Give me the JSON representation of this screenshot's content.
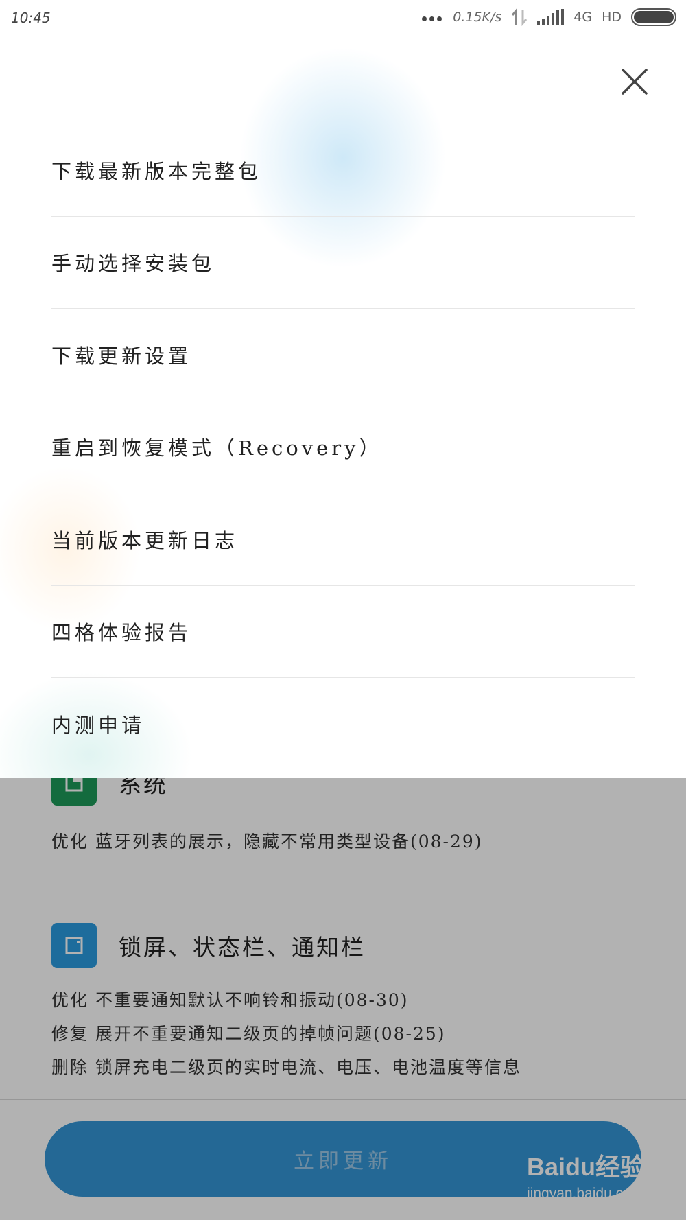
{
  "status_bar": {
    "time": "10:45",
    "net_speed": "0.15K/s",
    "network": "4G",
    "hd": "HD"
  },
  "menu": {
    "items": [
      {
        "label": "下载最新版本完整包"
      },
      {
        "label": "手动选择安装包"
      },
      {
        "label": "下载更新设置"
      },
      {
        "label": "重启到恢复模式（Recovery）"
      },
      {
        "label": "当前版本更新日志"
      },
      {
        "label": "四格体验报告"
      },
      {
        "label": "内测申请"
      }
    ]
  },
  "background": {
    "system_section": {
      "title": "系统",
      "notes": [
        "优化 蓝牙列表的展示，隐藏不常用类型设备(08-29)"
      ]
    },
    "lockscreen_section": {
      "title": "锁屏、状态栏、通知栏",
      "notes": [
        "优化 不重要通知默认不响铃和振动(08-30)",
        "修复 展开不重要通知二级页的掉帧问题(08-25)",
        "删除 锁屏充电二级页的实时电流、电压、电池温度等信息"
      ]
    },
    "update_button_label": "立即更新"
  },
  "colors": {
    "system_icon": "#1e9a5a",
    "lockscreen_icon": "#2a9be0",
    "update_button": "#3496d6"
  },
  "watermark": {
    "brand": "Baidu经验",
    "url": "jingyan.baidu.com"
  }
}
